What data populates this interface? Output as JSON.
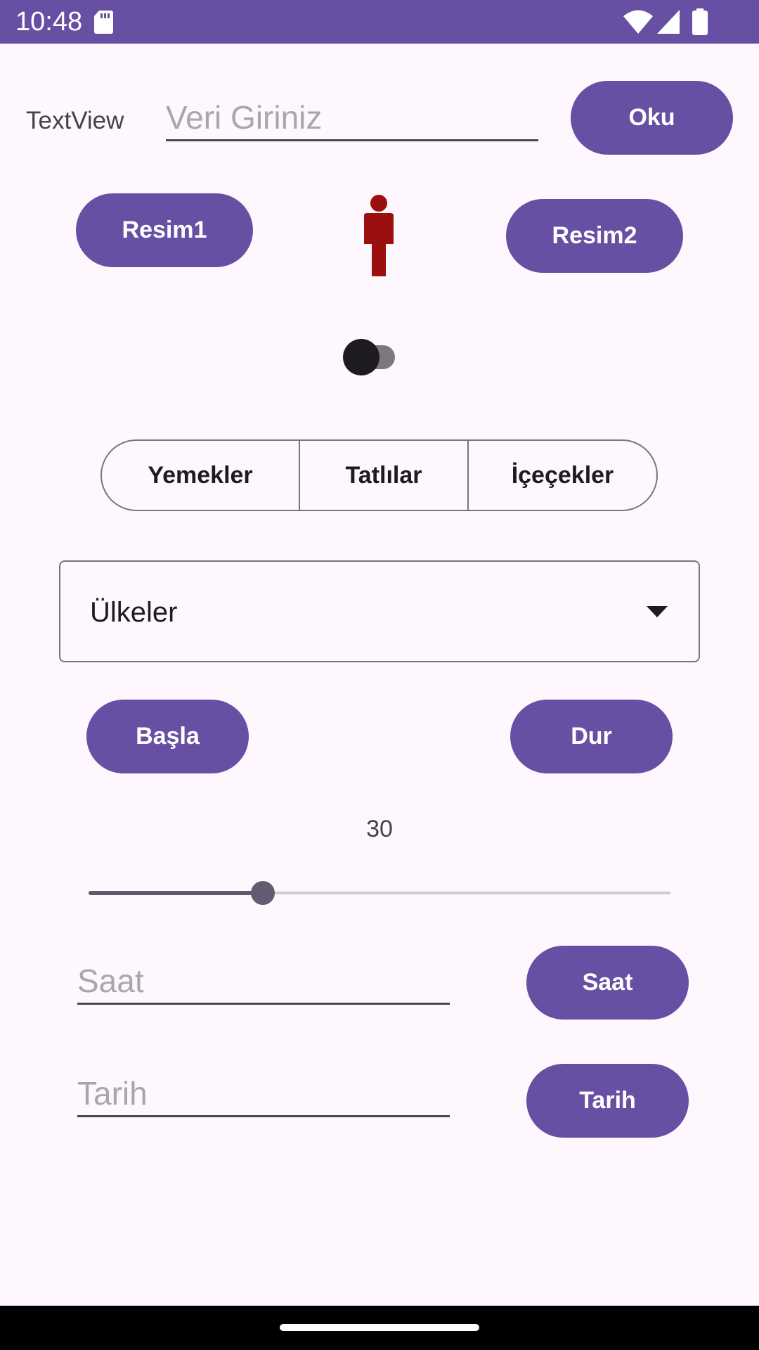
{
  "status_bar": {
    "time": "10:48",
    "icons": [
      "sd-card-icon",
      "wifi-icon",
      "signal-icon",
      "battery-icon"
    ]
  },
  "row1": {
    "label": "TextView",
    "input_placeholder": "Veri Giriniz",
    "button": "Oku"
  },
  "row2": {
    "button_left": "Resim1",
    "image_icon": "person-icon",
    "image_color": "#9b0f0f",
    "button_right": "Resim2"
  },
  "switch": {
    "checked": false
  },
  "segments": [
    "Yemekler",
    "Tatlılar",
    "İçeçekler"
  ],
  "dropdown": {
    "value": "Ülkeler",
    "icon": "arrow-drop-down-icon"
  },
  "progress_buttons": {
    "start": "Başla",
    "stop": "Dur"
  },
  "seekbar": {
    "value": "30",
    "max": 100
  },
  "time_row": {
    "placeholder": "Saat",
    "button": "Saat"
  },
  "date_row": {
    "placeholder": "Tarih",
    "button": "Tarih"
  },
  "colors": {
    "primary": "#6750a4",
    "background": "#fef7fe",
    "image_red": "#9b0f0f"
  }
}
